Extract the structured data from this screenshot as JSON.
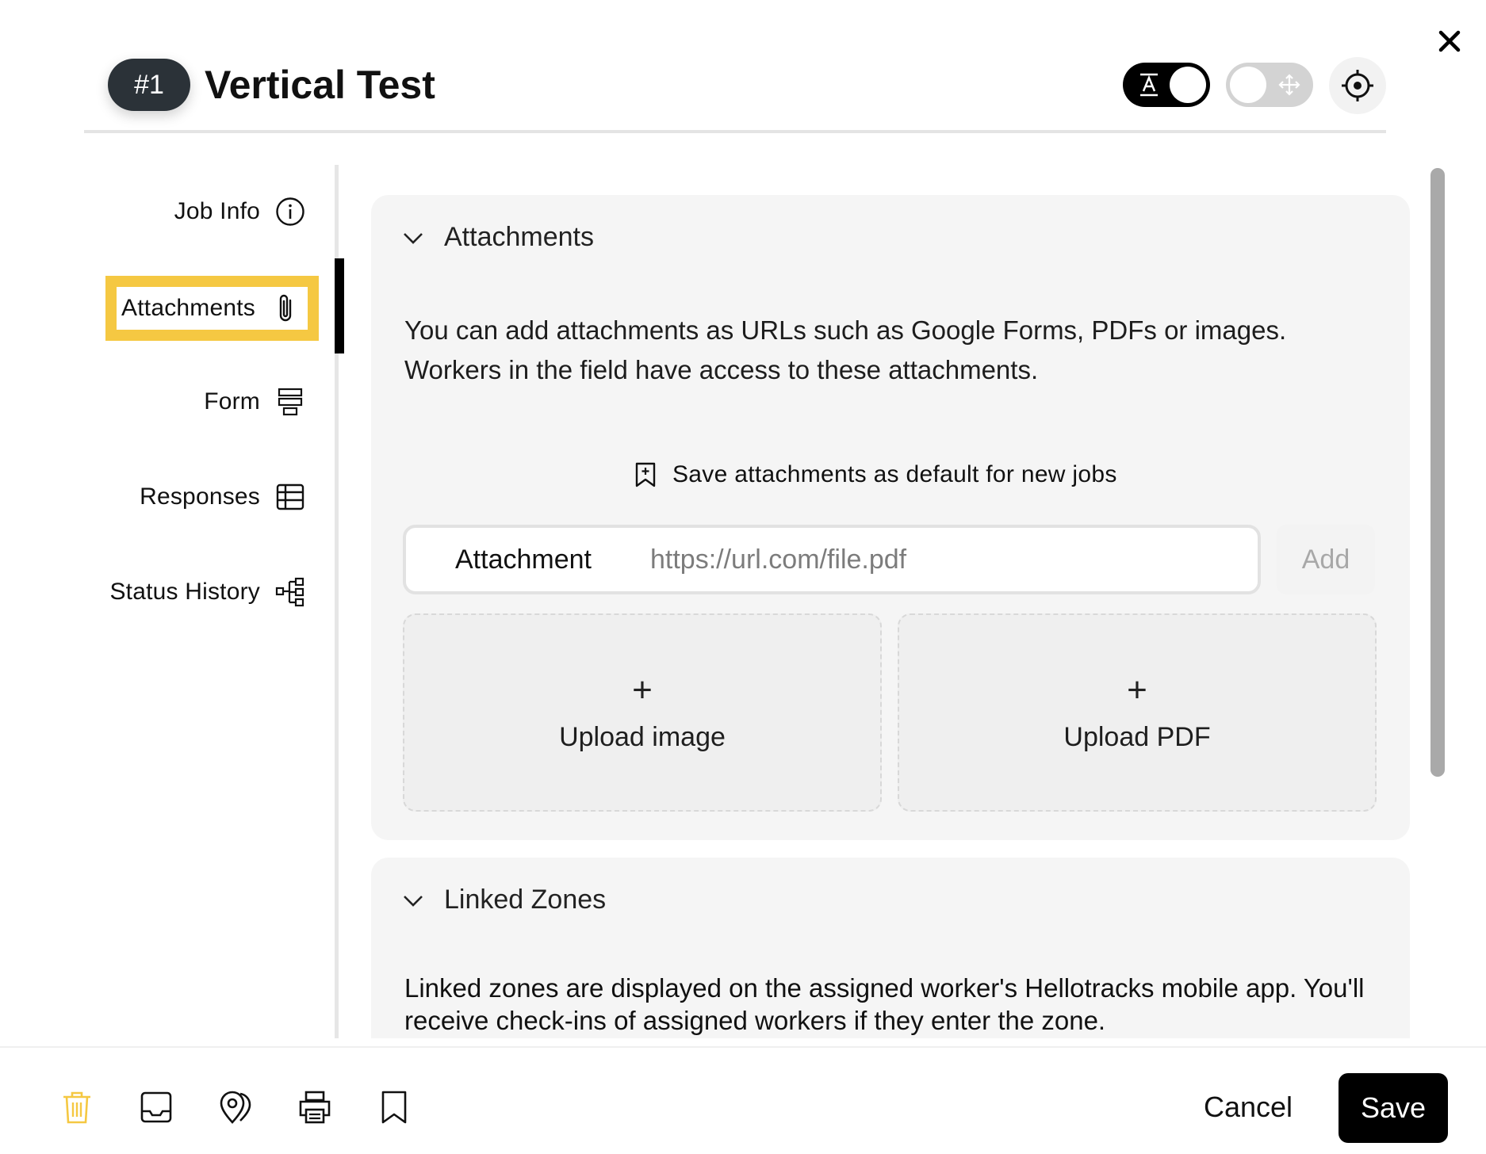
{
  "header": {
    "badge": "#1",
    "title": "Vertical Test"
  },
  "sidebar": {
    "items": [
      {
        "label": "Job Info",
        "icon": "info-icon",
        "active": false
      },
      {
        "label": "Attachments",
        "icon": "paperclip-icon",
        "active": true
      },
      {
        "label": "Form",
        "icon": "form-icon",
        "active": false
      },
      {
        "label": "Responses",
        "icon": "table-icon",
        "active": false
      },
      {
        "label": "Status History",
        "icon": "hierarchy-icon",
        "active": false
      }
    ]
  },
  "attachments": {
    "title": "Attachments",
    "description": "You can add attachments as URLs such as Google Forms, PDFs or images. Workers in the field have access to these attachments.",
    "save_default": "Save attachments as default for new jobs",
    "field_label": "Attachment",
    "field_placeholder": "https://url.com/file.pdf",
    "add_label": "Add",
    "upload_image": {
      "plus": "+",
      "label": "Upload image"
    },
    "upload_pdf": {
      "plus": "+",
      "label": "Upload PDF"
    }
  },
  "linked_zones": {
    "title": "Linked Zones",
    "description": "Linked zones are displayed on the assigned worker's Hellotracks mobile app. You'll receive check-ins of assigned workers if they enter the zone."
  },
  "footer": {
    "cancel_label": "Cancel",
    "save_label": "Save",
    "icons": [
      "trash-icon",
      "inbox-icon",
      "location-pin-icon",
      "printer-icon",
      "bookmark-icon"
    ]
  },
  "colors": {
    "highlight": "#f5c842",
    "trash": "#f5c842",
    "badge_bg": "#2b3238",
    "card_bg": "#f5f5f5"
  }
}
